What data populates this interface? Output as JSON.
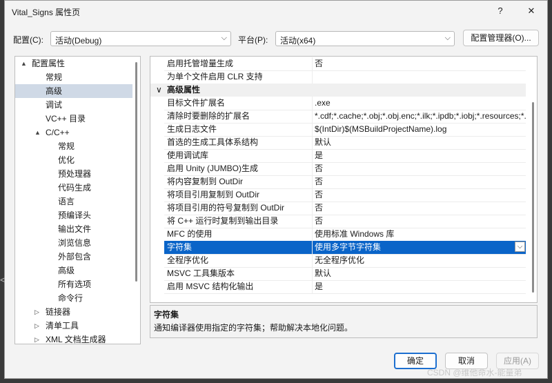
{
  "window": {
    "title": "Vital_Signs 属性页",
    "help": "?",
    "close": "✕"
  },
  "config": {
    "config_label": "配置(C):",
    "config_value": "活动(Debug)",
    "platform_label": "平台(P):",
    "platform_value": "活动(x64)",
    "manager_button": "配置管理器(O)..."
  },
  "tree": {
    "items": [
      {
        "label": "配置属性",
        "twisty": "▲"
      },
      {
        "label": "常规"
      },
      {
        "label": "高级"
      },
      {
        "label": "调试"
      },
      {
        "label": "VC++ 目录"
      },
      {
        "label": "C/C++",
        "twisty": "▲"
      },
      {
        "label": "常规"
      },
      {
        "label": "优化"
      },
      {
        "label": "预处理器"
      },
      {
        "label": "代码生成"
      },
      {
        "label": "语言"
      },
      {
        "label": "预编译头"
      },
      {
        "label": "输出文件"
      },
      {
        "label": "浏览信息"
      },
      {
        "label": "外部包含"
      },
      {
        "label": "高级"
      },
      {
        "label": "所有选项"
      },
      {
        "label": "命令行"
      },
      {
        "label": "链接器",
        "twisty": "▷"
      },
      {
        "label": "清单工具",
        "twisty": "▷"
      },
      {
        "label": "XML 文档生成器",
        "twisty": "▷"
      }
    ]
  },
  "grid": {
    "top_rows": [
      {
        "name": "启用托管增量生成",
        "value": "否"
      },
      {
        "name": "为单个文件启用 CLR 支持",
        "value": ""
      }
    ],
    "category": {
      "label": "高级属性",
      "chevron": "∨"
    },
    "rows": [
      {
        "name": "目标文件扩展名",
        "value": ".exe"
      },
      {
        "name": "清除时要删除的扩展名",
        "value": "*.cdf;*.cache;*.obj;*.obj.enc;*.ilk;*.ipdb;*.iobj;*.resources;*.tlb;*.tli;*.tlh;"
      },
      {
        "name": "生成日志文件",
        "value": "$(IntDir)$(MSBuildProjectName).log"
      },
      {
        "name": "首选的生成工具体系结构",
        "value": "默认"
      },
      {
        "name": "使用调试库",
        "value": "是"
      },
      {
        "name": "启用 Unity (JUMBO)生成",
        "value": "否"
      },
      {
        "name": "将内容复制到 OutDir",
        "value": "否"
      },
      {
        "name": "将项目引用复制到 OutDir",
        "value": "否"
      },
      {
        "name": "将项目引用的符号复制到 OutDir",
        "value": "否"
      },
      {
        "name": "将 C++ 运行时复制到输出目录",
        "value": "否"
      },
      {
        "name": "MFC 的使用",
        "value": "使用标准 Windows 库"
      },
      {
        "name": "字符集",
        "value": "使用多字节字符集"
      },
      {
        "name": "全程序优化",
        "value": "无全程序优化"
      },
      {
        "name": "MSVC 工具集版本",
        "value": "默认"
      },
      {
        "name": "启用 MSVC 结构化输出",
        "value": "是"
      }
    ],
    "dropdown_arrow": "⌵"
  },
  "description": {
    "title": "字符集",
    "text": "通知编译器使用指定的字符集；帮助解决本地化问题。"
  },
  "buttons": {
    "ok": "确定",
    "cancel": "取消",
    "apply": "应用(A)"
  },
  "watermark": "CSDN @维他命水-能量弟",
  "left_edge_glyph": "<"
}
